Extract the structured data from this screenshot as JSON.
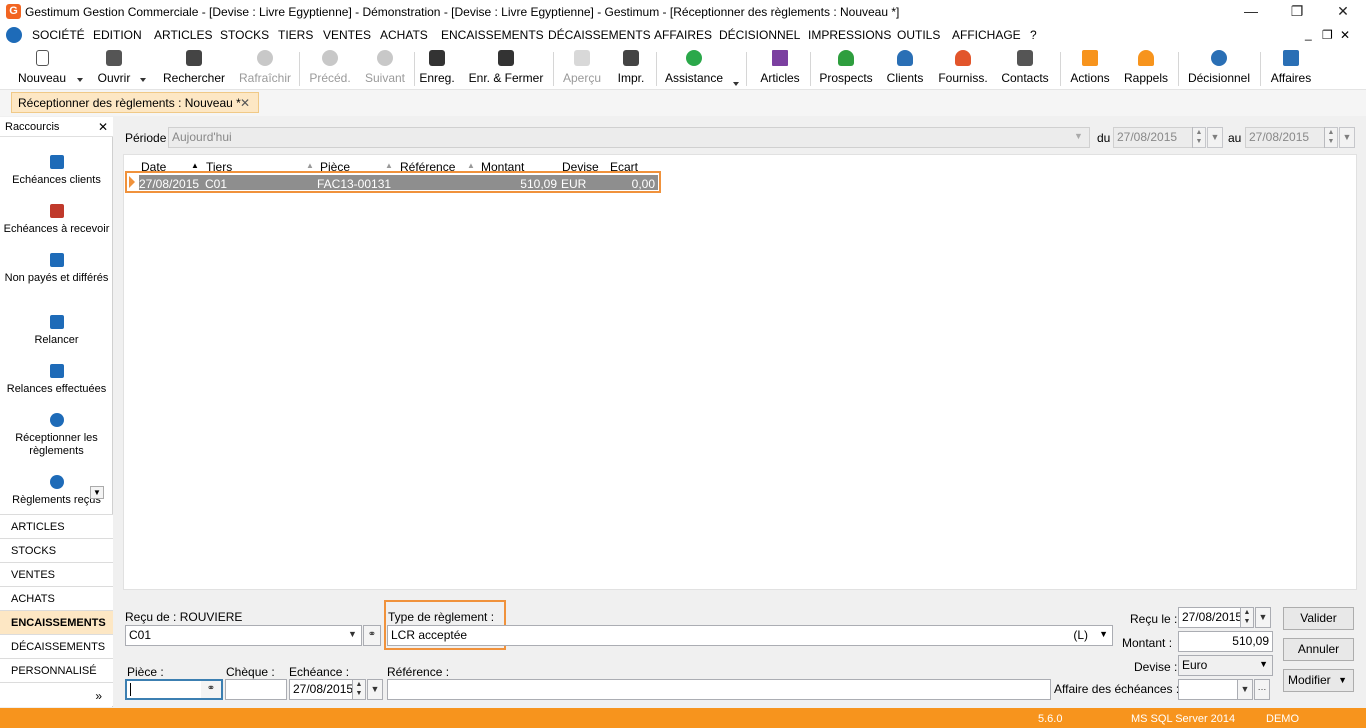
{
  "window": {
    "title": "Gestimum Gestion Commerciale - [Devise : Livre Egyptienne] - Démonstration - [Devise : Livre Egyptienne] - Gestimum - [Réceptionner des règlements : Nouveau *]",
    "logo_letter": "G",
    "minimize": "—",
    "restore": "❐",
    "close": "✕"
  },
  "menu": [
    "SOCIÉTÉ",
    "EDITION",
    "ARTICLES",
    "STOCKS",
    "TIERS",
    "VENTES",
    "ACHATS",
    "ENCAISSEMENTS",
    "DÉCAISSEMENTS",
    "AFFAIRES",
    "DÉCISIONNEL",
    "IMPRESSIONS",
    "OUTILS",
    "AFFICHAGE",
    "?"
  ],
  "menu_right": {
    "min": "_",
    "restore": "❐",
    "close": "✕"
  },
  "toolbar": [
    {
      "label": "Nouveau",
      "icon": "new-document-icon",
      "color": "#ffffff",
      "enabled": true
    },
    {
      "label": "Ouvrir",
      "icon": "open-folder-icon",
      "color": "#555555",
      "enabled": true
    },
    {
      "label": "Rechercher",
      "icon": "binoculars-icon",
      "color": "#444444",
      "enabled": true
    },
    {
      "label": "Rafraîchir",
      "icon": "refresh-icon",
      "color": "#c8c8c8",
      "enabled": false
    },
    {
      "label": "Précéd.",
      "icon": "previous-icon",
      "color": "#c8c8c8",
      "enabled": false
    },
    {
      "label": "Suivant",
      "icon": "next-icon",
      "color": "#c8c8c8",
      "enabled": false
    },
    {
      "label": "Enreg.",
      "icon": "save-icon",
      "color": "#333333",
      "enabled": true
    },
    {
      "label": "Enr. & Fermer",
      "icon": "save-close-icon",
      "color": "#333333",
      "enabled": true
    },
    {
      "label": "Aperçu",
      "icon": "preview-icon",
      "color": "#d8d8d8",
      "enabled": false
    },
    {
      "label": "Impr.",
      "icon": "print-icon",
      "color": "#444444",
      "enabled": true
    },
    {
      "label": "Assistance",
      "icon": "whatsapp-icon",
      "color": "#2ba84a",
      "enabled": true
    },
    {
      "label": "Articles",
      "icon": "articles-icon",
      "color": "#7b3fa0",
      "enabled": true
    },
    {
      "label": "Prospects",
      "icon": "prospect-person-icon",
      "color": "#2e9e3e",
      "enabled": true
    },
    {
      "label": "Clients",
      "icon": "client-person-icon",
      "color": "#2a6fb5",
      "enabled": true
    },
    {
      "label": "Fourniss.",
      "icon": "supplier-person-icon",
      "color": "#e2552b",
      "enabled": true
    },
    {
      "label": "Contacts",
      "icon": "contacts-icon",
      "color": "#555555",
      "enabled": true
    },
    {
      "label": "Actions",
      "icon": "actions-check-icon",
      "color": "#f7941d",
      "enabled": true
    },
    {
      "label": "Rappels",
      "icon": "bell-icon",
      "color": "#f7941d",
      "enabled": true
    },
    {
      "label": "Décisionnel",
      "icon": "pie-chart-icon",
      "color": "#2a6fb5",
      "enabled": true
    },
    {
      "label": "Affaires",
      "icon": "affaires-icon",
      "color": "#2a6fb5",
      "enabled": true
    }
  ],
  "doc_tab": {
    "label": "Réceptionner des règlements : Nouveau *",
    "close": "✕"
  },
  "leftpanel": {
    "header": "Raccourcis",
    "close": "✕",
    "shortcuts": [
      {
        "label": "Echéances clients"
      },
      {
        "label": "Echéances à recevoir"
      },
      {
        "label": "Non payés et différés"
      },
      {
        "label": "Relancer"
      },
      {
        "label": "Relances effectuées"
      },
      {
        "label": "Réceptionner les règlements"
      },
      {
        "label": "Règlements reçus"
      }
    ],
    "categories": [
      "ARTICLES",
      "STOCKS",
      "VENTES",
      "ACHATS",
      "ENCAISSEMENTS",
      "DÉCAISSEMENTS",
      "PERSONNALISÉ"
    ],
    "active_category": "ENCAISSEMENTS",
    "more": "»"
  },
  "period": {
    "label": "Période",
    "value": "Aujourd'hui",
    "from_label": "du",
    "from": "27/08/2015",
    "to_label": "au",
    "to": "27/08/2015"
  },
  "grid": {
    "columns": [
      "Date",
      "Tiers",
      "Pièce",
      "Référence",
      "Montant",
      "Devise",
      "Ecart"
    ],
    "rows": [
      {
        "date": "27/08/2015",
        "tiers": "C01",
        "piece": "FAC13-00131",
        "reference": "",
        "montant": "510,09",
        "devise": "EUR",
        "ecart": "0,00"
      }
    ]
  },
  "form": {
    "recu_de_label": "Reçu de : ROUVIERE",
    "tiers_value": "C01",
    "type_label": "Type de règlement :",
    "type_value": "LCR acceptée",
    "type_code": "(L)",
    "recu_le_label": "Reçu le :",
    "recu_le": "27/08/2015",
    "montant_label": "Montant :",
    "montant": "510,09",
    "devise_label": "Devise :",
    "devise": "Euro",
    "piece_label": "Pièce :",
    "piece": "",
    "cheque_label": "Chèque :",
    "cheque": "",
    "echeance_label": "Echéance :",
    "echeance": "27/08/2015",
    "reference_label": "Référence :",
    "reference": "",
    "affaire_label": "Affaire des échéances :",
    "affaire": ""
  },
  "buttons": {
    "valider": "Valider",
    "annuler": "Annuler",
    "modifier": "Modifier"
  },
  "status": {
    "version": "5.6.0",
    "db": "MS SQL Server 2014",
    "mode": "DEMO"
  }
}
